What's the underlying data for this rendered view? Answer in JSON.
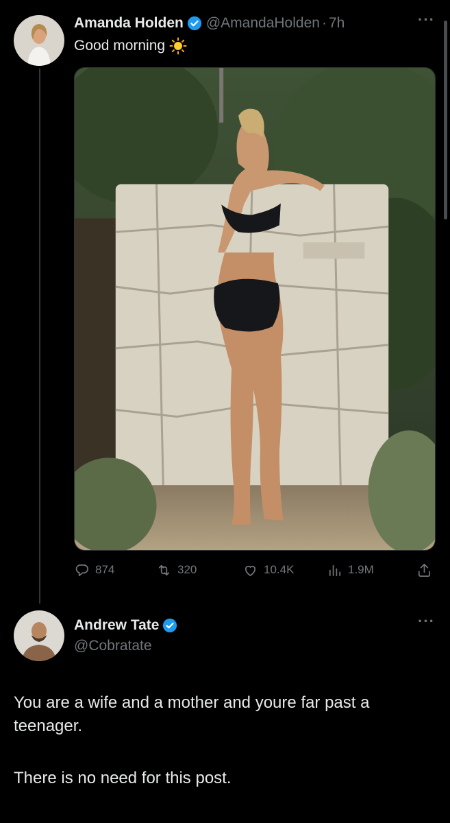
{
  "post": {
    "author_name": "Amanda Holden",
    "handle": "@AmandaHolden",
    "separator": "·",
    "time": "7h",
    "text": "Good morning",
    "text_emoji_icon": "sun-icon",
    "more_icon_label": "···",
    "stats": {
      "replies": "874",
      "retweets": "320",
      "likes": "10.4K",
      "views": "1.9M"
    },
    "accent_color": "#1d9bf0"
  },
  "reply": {
    "author_name": "Andrew Tate",
    "handle": "@Cobratate",
    "more_icon_label": "···",
    "paragraphs": [
      "You are a wife and a mother and youre far past a teenager.",
      "There is no need for this post."
    ]
  }
}
